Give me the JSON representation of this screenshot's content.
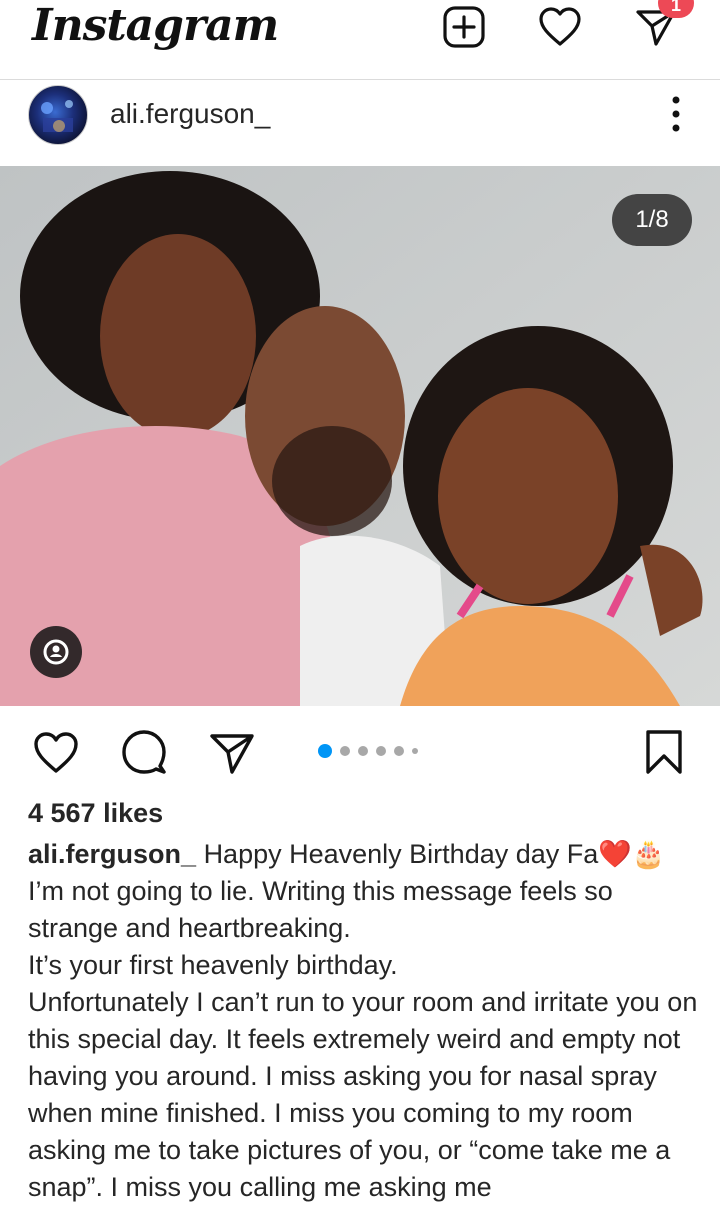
{
  "header": {
    "logo": "Instagram",
    "notification_count": "1"
  },
  "post": {
    "username": "ali.ferguson_",
    "image_counter": "1/8",
    "carousel": {
      "total_dots": 6,
      "active_index": 0
    },
    "likes": "4 567 likes",
    "caption_first": "Happy Heavenly Birthday day Fa",
    "caption_emojis": "❤️🎂",
    "caption_lines": [
      "I’m not going to lie. Writing this message feels so strange and heartbreaking.",
      "It’s your first heavenly birthday.",
      "Unfortunately I can’t run to your room and irritate you on this special day. It feels extremely weird and empty not having you around. I miss asking you for nasal spray when mine finished. I miss you coming to my room asking me to take pictures of you, or “come take me a snap”. I miss you calling me asking me"
    ]
  },
  "icons": [
    "new-post-icon",
    "heart-icon",
    "direct-message-icon",
    "more-options-icon",
    "user-tag-icon",
    "like-icon",
    "comment-icon",
    "share-icon",
    "bookmark-icon"
  ]
}
